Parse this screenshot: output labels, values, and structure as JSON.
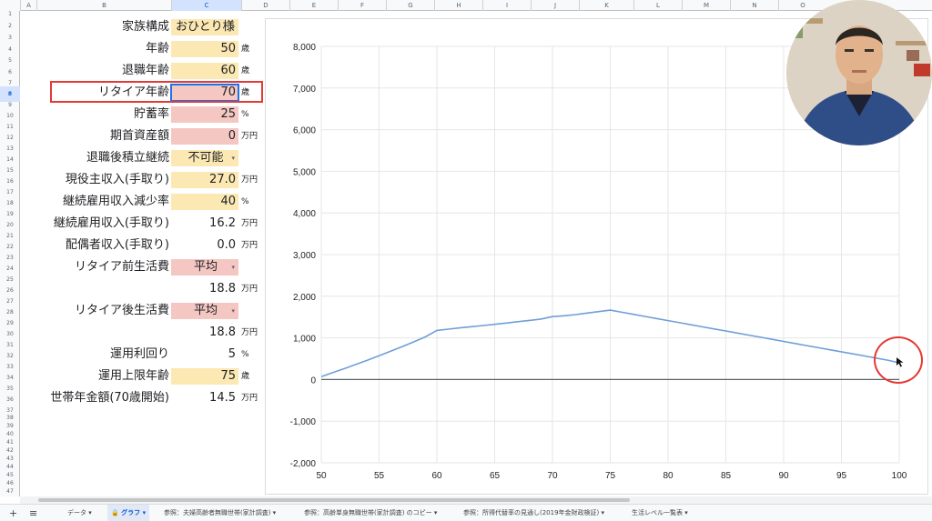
{
  "columns": [
    "A",
    "B",
    "C",
    "D",
    "E",
    "F",
    "G",
    "H",
    "I",
    "J",
    "K",
    "L",
    "M",
    "N",
    "O"
  ],
  "rows": [
    {
      "n": "1",
      "y": 12,
      "h": 8
    },
    {
      "n": "2",
      "y": 20,
      "h": 18
    },
    {
      "n": "3",
      "y": 38,
      "h": 8
    },
    {
      "n": "4",
      "y": 46,
      "h": 17
    },
    {
      "n": "5",
      "y": 63,
      "h": 8
    },
    {
      "n": "6",
      "y": 71,
      "h": 17
    },
    {
      "n": "7",
      "y": 88,
      "h": 7
    },
    {
      "n": "8",
      "y": 95,
      "h": 17
    },
    {
      "n": "9",
      "y": 112,
      "h": 7
    },
    {
      "n": "10",
      "y": 119,
      "h": 17
    },
    {
      "n": "11",
      "y": 136,
      "h": 7
    },
    {
      "n": "12",
      "y": 143,
      "h": 17
    },
    {
      "n": "13",
      "y": 160,
      "h": 7
    },
    {
      "n": "14",
      "y": 167,
      "h": 17
    },
    {
      "n": "15",
      "y": 184,
      "h": 7
    },
    {
      "n": "16",
      "y": 191,
      "h": 17
    },
    {
      "n": "17",
      "y": 208,
      "h": 7
    },
    {
      "n": "18",
      "y": 215,
      "h": 17
    },
    {
      "n": "19",
      "y": 232,
      "h": 7
    },
    {
      "n": "20",
      "y": 239,
      "h": 17
    },
    {
      "n": "21",
      "y": 256,
      "h": 7
    },
    {
      "n": "22",
      "y": 263,
      "h": 17
    },
    {
      "n": "23",
      "y": 280,
      "h": 7
    },
    {
      "n": "24",
      "y": 287,
      "h": 17
    },
    {
      "n": "25",
      "y": 304,
      "h": 7
    },
    {
      "n": "26",
      "y": 311,
      "h": 17
    },
    {
      "n": "27",
      "y": 328,
      "h": 7
    },
    {
      "n": "28",
      "y": 335,
      "h": 17
    },
    {
      "n": "29",
      "y": 352,
      "h": 7
    },
    {
      "n": "30",
      "y": 359,
      "h": 17
    },
    {
      "n": "31",
      "y": 376,
      "h": 7
    },
    {
      "n": "32",
      "y": 383,
      "h": 17
    },
    {
      "n": "33",
      "y": 400,
      "h": 7
    },
    {
      "n": "34",
      "y": 407,
      "h": 17
    },
    {
      "n": "35",
      "y": 424,
      "h": 7
    },
    {
      "n": "36",
      "y": 431,
      "h": 17
    },
    {
      "n": "37",
      "y": 448,
      "h": 7
    },
    {
      "n": "38",
      "y": 455,
      "h": 9
    },
    {
      "n": "39",
      "y": 464,
      "h": 9
    },
    {
      "n": "40",
      "y": 473,
      "h": 9
    },
    {
      "n": "41",
      "y": 482,
      "h": 9
    },
    {
      "n": "42",
      "y": 491,
      "h": 9
    },
    {
      "n": "43",
      "y": 500,
      "h": 9
    },
    {
      "n": "44",
      "y": 509,
      "h": 9
    },
    {
      "n": "45",
      "y": 518,
      "h": 9
    },
    {
      "n": "46",
      "y": 527,
      "h": 9
    },
    {
      "n": "47",
      "y": 536,
      "h": 10
    }
  ],
  "fields": {
    "family": {
      "label": "家族構成",
      "value": "おひとり様"
    },
    "age": {
      "label": "年齢",
      "value": "50",
      "unit": "歳"
    },
    "retire_age": {
      "label": "退職年齢",
      "value": "60",
      "unit": "歳"
    },
    "retire_full_age": {
      "label": "リタイア年齢",
      "value": "70",
      "unit": "歳"
    },
    "savings_rate": {
      "label": "貯蓄率",
      "value": "25",
      "unit": "%"
    },
    "initial_assets": {
      "label": "期首資産額",
      "value": "0",
      "unit": "万円"
    },
    "continue_saving": {
      "label": "退職後積立継続",
      "value": "不可能"
    },
    "income": {
      "label": "現役主収入(手取り)",
      "value": "27.0",
      "unit": "万円"
    },
    "reemploy_cut": {
      "label": "継続雇用収入減少率",
      "value": "40",
      "unit": "%"
    },
    "reemploy_income": {
      "label": "継続雇用収入(手取り)",
      "value": "16.2",
      "unit": "万円"
    },
    "spouse_income": {
      "label": "配偶者収入(手取り)",
      "value": "0.0",
      "unit": "万円"
    },
    "pre_living": {
      "label": "リタイア前生活費",
      "value": "平均",
      "amount": "18.8",
      "unit": "万円"
    },
    "post_living": {
      "label": "リタイア後生活費",
      "value": "平均",
      "amount": "18.8",
      "unit": "万円"
    },
    "yield": {
      "label": "運用利回り",
      "value": "5",
      "unit": "%"
    },
    "invest_limit_age": {
      "label": "運用上限年齢",
      "value": "75",
      "unit": "歳"
    },
    "pension": {
      "label": "世帯年金額(70歳開始)",
      "value": "14.5",
      "unit": "万円"
    }
  },
  "icons": {
    "dropdown": "▾",
    "add": "+",
    "menu": "≡",
    "lock": "🔒"
  },
  "sheet_tabs": [
    {
      "label": "データ ▾",
      "active": false
    },
    {
      "label": "🔒 グラフ ▾",
      "active": true
    },
    {
      "label": "参照：夫婦高齢者無職世帯(家計調査) ▾",
      "active": false
    },
    {
      "label": "参照：高齢単身無職世帯(家計調査) のコピー ▾",
      "active": false
    },
    {
      "label": "参照：所得代替率の見通し(2019年金財政検証) ▾",
      "active": false
    },
    {
      "label": "生活レベル一覧表 ▾",
      "active": false
    }
  ],
  "colors": {
    "line": "#6f9fd8",
    "highlight": "#e53935",
    "selection": "#1a73e8"
  },
  "chart_data": {
    "type": "line",
    "x": [
      50,
      51,
      52,
      53,
      54,
      55,
      56,
      57,
      58,
      59,
      60,
      61,
      62,
      63,
      64,
      65,
      66,
      67,
      68,
      69,
      70,
      71,
      72,
      73,
      74,
      75,
      76,
      77,
      78,
      79,
      80,
      81,
      82,
      83,
      84,
      85,
      86,
      87,
      88,
      89,
      90,
      91,
      92,
      93,
      94,
      95,
      96,
      97,
      98,
      99,
      100
    ],
    "series": [
      {
        "values": [
          70,
          165,
          262,
          362,
          465,
          570,
          679,
          790,
          905,
          1023,
          1180,
          1210,
          1240,
          1268,
          1296,
          1325,
          1356,
          1388,
          1420,
          1452,
          1510,
          1530,
          1560,
          1595,
          1630,
          1665,
          1615,
          1565,
          1515,
          1465,
          1415,
          1365,
          1315,
          1265,
          1215,
          1165,
          1115,
          1065,
          1015,
          965,
          915,
          865,
          815,
          765,
          715,
          665,
          615,
          565,
          515,
          465,
          400
        ]
      }
    ],
    "xticks": [
      50,
      55,
      60,
      65,
      70,
      75,
      80,
      85,
      90,
      95,
      100
    ],
    "yticks": [
      -2000,
      -1000,
      0,
      1000,
      2000,
      3000,
      4000,
      5000,
      6000,
      7000,
      8000
    ],
    "yticklabels": [
      "-2,000",
      "-1,000",
      "0",
      "1,000",
      "2,000",
      "3,000",
      "4,000",
      "5,000",
      "6,000",
      "7,000",
      "8,000"
    ],
    "xlim": [
      50,
      100
    ],
    "ylim": [
      -2000,
      8000
    ],
    "grid": true,
    "legend": "none"
  }
}
